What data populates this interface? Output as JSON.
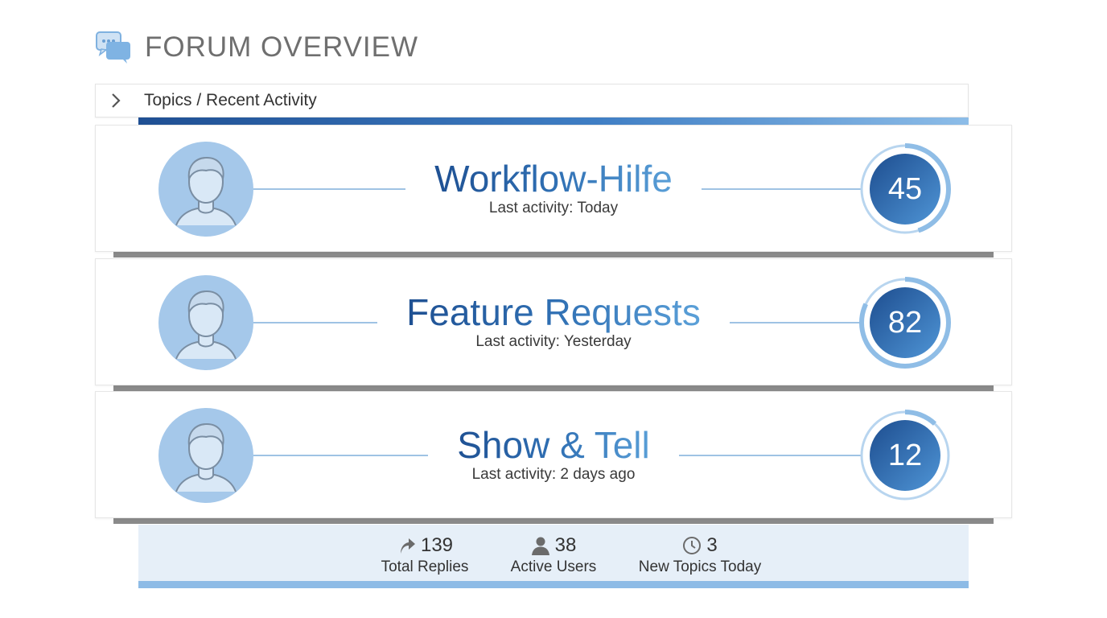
{
  "header": {
    "title": "FORUM OVERVIEW"
  },
  "breadcrumb": {
    "text": "Topics / Recent Activity"
  },
  "topics": [
    {
      "title": "Workflow-Hilfe",
      "activity": "Last activity: Today",
      "count": "45",
      "fraction": 0.45
    },
    {
      "title": "Feature Requests",
      "activity": "Last activity: Yesterday",
      "count": "82",
      "fraction": 0.82
    },
    {
      "title": "Show & Tell",
      "activity": "Last activity: 2 days ago",
      "count": "12",
      "fraction": 0.12
    }
  ],
  "stats": [
    {
      "icon": "reply-arrow-icon",
      "value": "139",
      "label": "Total Replies"
    },
    {
      "icon": "user-icon",
      "value": "38",
      "label": "Active Users"
    },
    {
      "icon": "clock-icon",
      "value": "3",
      "label": "New Topics Today"
    }
  ],
  "colors": {
    "primary_dark": "#1d4d8f",
    "primary_light": "#5fa5dc",
    "avatar_bg": "#a5c8ea",
    "stats_bg": "#e6eff8"
  }
}
